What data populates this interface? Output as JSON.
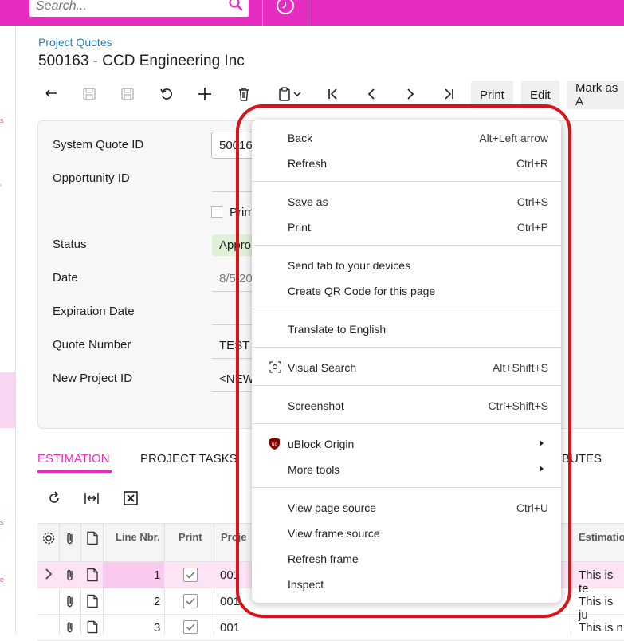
{
  "search": {
    "placeholder": "Search..."
  },
  "left_rail": {
    "items": [
      "s",
      "’",
      "s",
      "e"
    ]
  },
  "header": {
    "breadcrumb": "Project Quotes",
    "title": "500163 - CCD Engineering Inc"
  },
  "toolbar": {
    "print_label": "Print",
    "edit_label": "Edit",
    "mark_label": "Mark as A"
  },
  "form": {
    "system_quote_id_label": "System Quote ID",
    "system_quote_id_value": "50016",
    "opportunity_id_label": "Opportunity ID",
    "primary_label": "Prim",
    "status_label": "Status",
    "status_value": "Appro",
    "date_label": "Date",
    "date_value": "8/5/20",
    "expiration_label": "Expiration Date",
    "quote_number_label": "Quote Number",
    "quote_number_value": "TEST",
    "new_project_label": "New Project ID",
    "new_project_value": "<NEW"
  },
  "tabs": {
    "estimation": "ESTIMATION",
    "project_tasks": "PROJECT TASKS",
    "attributes": "BUTES"
  },
  "grid": {
    "headers": {
      "line_nbr": "Line Nbr.",
      "print": "Print",
      "project": "Proje",
      "estimation": "Estimatio"
    },
    "rows": [
      {
        "line": "1",
        "project": "001",
        "estimation": "This is te"
      },
      {
        "line": "2",
        "project": "001",
        "estimation": "This is ju"
      },
      {
        "line": "3",
        "project": "001",
        "estimation": "This is n"
      }
    ]
  },
  "context_menu": {
    "back": {
      "label": "Back",
      "shortcut": "Alt+Left arrow"
    },
    "refresh": {
      "label": "Refresh",
      "shortcut": "Ctrl+R"
    },
    "save_as": {
      "label": "Save as",
      "shortcut": "Ctrl+S"
    },
    "print": {
      "label": "Print",
      "shortcut": "Ctrl+P"
    },
    "send_tab": {
      "label": "Send tab to your devices"
    },
    "qr": {
      "label": "Create QR Code for this page"
    },
    "translate": {
      "label": "Translate to English"
    },
    "visual_search": {
      "label": "Visual Search",
      "shortcut": "Alt+Shift+S"
    },
    "screenshot": {
      "label": "Screenshot",
      "shortcut": "Ctrl+Shift+S"
    },
    "ublock": {
      "label": "uBlock Origin"
    },
    "more_tools": {
      "label": "More tools"
    },
    "view_source": {
      "label": "View page source",
      "shortcut": "Ctrl+U"
    },
    "view_frame_source": {
      "label": "View frame source"
    },
    "refresh_frame": {
      "label": "Refresh frame"
    },
    "inspect": {
      "label": "Inspect"
    }
  },
  "colors": {
    "brand": "#e62cc1",
    "link": "#1b84c5",
    "highlight": "#d8141a",
    "status_bg": "#dff0d8"
  }
}
